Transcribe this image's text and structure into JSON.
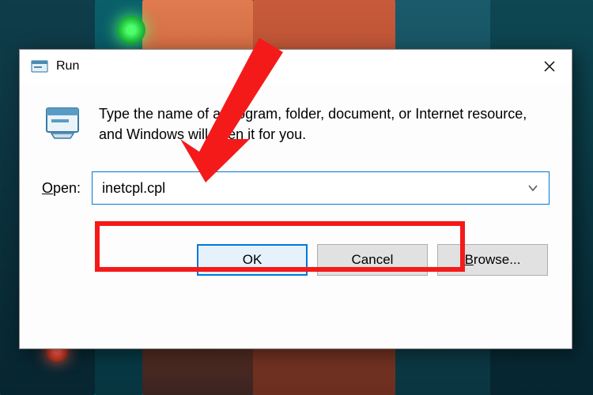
{
  "dialog": {
    "title": "Run",
    "description": "Type the name of a program, folder, document, or Internet resource, and Windows will open it for you.",
    "open_label_prefix": "O",
    "open_label_rest": "pen:",
    "input_value": "inetcpl.cpl",
    "buttons": {
      "ok": "OK",
      "cancel": "Cancel",
      "browse_prefix": "B",
      "browse_rest": "rowse..."
    }
  },
  "annotation": {
    "highlight_color": "#f51a1a",
    "arrow_color": "#f51a1a"
  }
}
